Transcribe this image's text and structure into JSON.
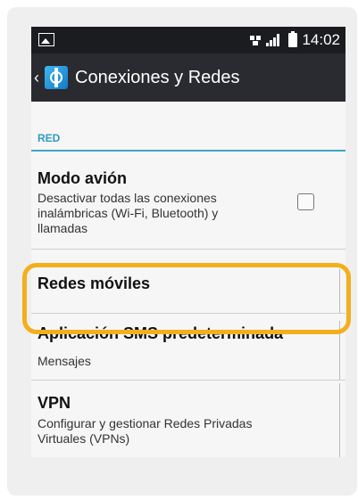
{
  "statusbar": {
    "time": "14:02",
    "left_icon": "image-notification-icon",
    "right_icons": [
      "sim-icon",
      "signal-icon",
      "battery-icon"
    ]
  },
  "appbar": {
    "back_icon": "back-chevron-icon",
    "app_icon": "connections-settings-icon",
    "title": "Conexiones y Redes"
  },
  "section": {
    "label": "RED"
  },
  "items": [
    {
      "title": "Modo avión",
      "subtitle_lines": [
        "Desactivar todas las conexiones",
        "inalámbricas (Wi-Fi, Bluetooth) y",
        "llamadas"
      ],
      "checked": false
    },
    {
      "title": "Redes móviles"
    },
    {
      "title": "Aplicación SMS predeterminada",
      "subtitle": "Mensajes"
    },
    {
      "title": "VPN",
      "subtitle_lines": [
        "Configurar y gestionar Redes Privadas",
        "Virtuales (VPNs)"
      ]
    }
  ],
  "colors": {
    "statusbar": "#1b1c1f",
    "appbar": "#2a2b30",
    "section_accent": "#2e9cbc",
    "highlight": "#f2b01e"
  }
}
